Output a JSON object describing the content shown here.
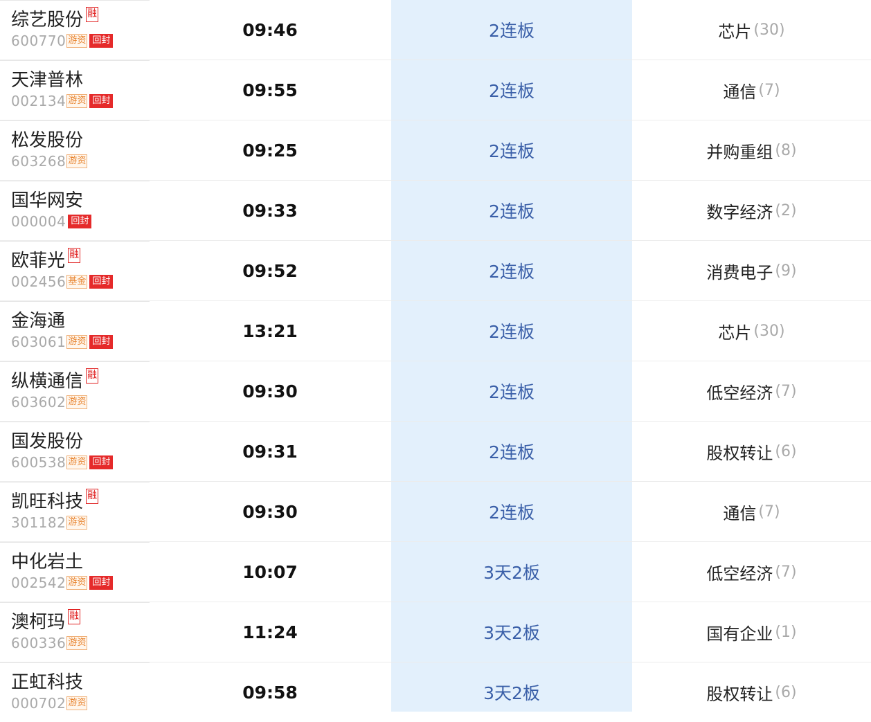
{
  "rows": [
    {
      "name": "综艺股份",
      "rong": "融",
      "code": "600770",
      "tags": [
        "游资",
        "回封"
      ],
      "time": "09:46",
      "board": "2连板",
      "concept": "芯片",
      "count": "(30)"
    },
    {
      "name": "天津普林",
      "rong": "",
      "code": "002134",
      "tags": [
        "游资",
        "回封"
      ],
      "time": "09:55",
      "board": "2连板",
      "concept": "通信",
      "count": "(7)"
    },
    {
      "name": "松发股份",
      "rong": "",
      "code": "603268",
      "tags": [
        "游资"
      ],
      "time": "09:25",
      "board": "2连板",
      "concept": "并购重组",
      "count": "(8)"
    },
    {
      "name": "国华网安",
      "rong": "",
      "code": "000004",
      "tags": [
        "回封"
      ],
      "time": "09:33",
      "board": "2连板",
      "concept": "数字经济",
      "count": "(2)"
    },
    {
      "name": "欧菲光",
      "rong": "融",
      "code": "002456",
      "tags": [
        "基金",
        "回封"
      ],
      "time": "09:52",
      "board": "2连板",
      "concept": "消费电子",
      "count": "(9)"
    },
    {
      "name": "金海通",
      "rong": "",
      "code": "603061",
      "tags": [
        "游资",
        "回封"
      ],
      "time": "13:21",
      "board": "2连板",
      "concept": "芯片",
      "count": "(30)"
    },
    {
      "name": "纵横通信",
      "rong": "融",
      "code": "603602",
      "tags": [
        "游资"
      ],
      "time": "09:30",
      "board": "2连板",
      "concept": "低空经济",
      "count": "(7)"
    },
    {
      "name": "国发股份",
      "rong": "",
      "code": "600538",
      "tags": [
        "游资",
        "回封"
      ],
      "time": "09:31",
      "board": "2连板",
      "concept": "股权转让",
      "count": "(6)"
    },
    {
      "name": "凯旺科技",
      "rong": "融",
      "code": "301182",
      "tags": [
        "游资"
      ],
      "time": "09:30",
      "board": "2连板",
      "concept": "通信",
      "count": "(7)"
    },
    {
      "name": "中化岩土",
      "rong": "",
      "code": "002542",
      "tags": [
        "游资",
        "回封"
      ],
      "time": "10:07",
      "board": "3天2板",
      "concept": "低空经济",
      "count": "(7)"
    },
    {
      "name": "澳柯玛",
      "rong": "融",
      "code": "600336",
      "tags": [
        "游资"
      ],
      "time": "11:24",
      "board": "3天2板",
      "concept": "国有企业",
      "count": "(1)"
    },
    {
      "name": "正虹科技",
      "rong": "",
      "code": "000702",
      "tags": [
        "游资"
      ],
      "time": "09:58",
      "board": "3天2板",
      "concept": "股权转让",
      "count": "(6)"
    }
  ],
  "colors": {
    "highlight": "#e3f0fc",
    "board_text": "#3a5fa8",
    "tag_red": "#e52a2a",
    "tag_orange": "#e8832e"
  }
}
